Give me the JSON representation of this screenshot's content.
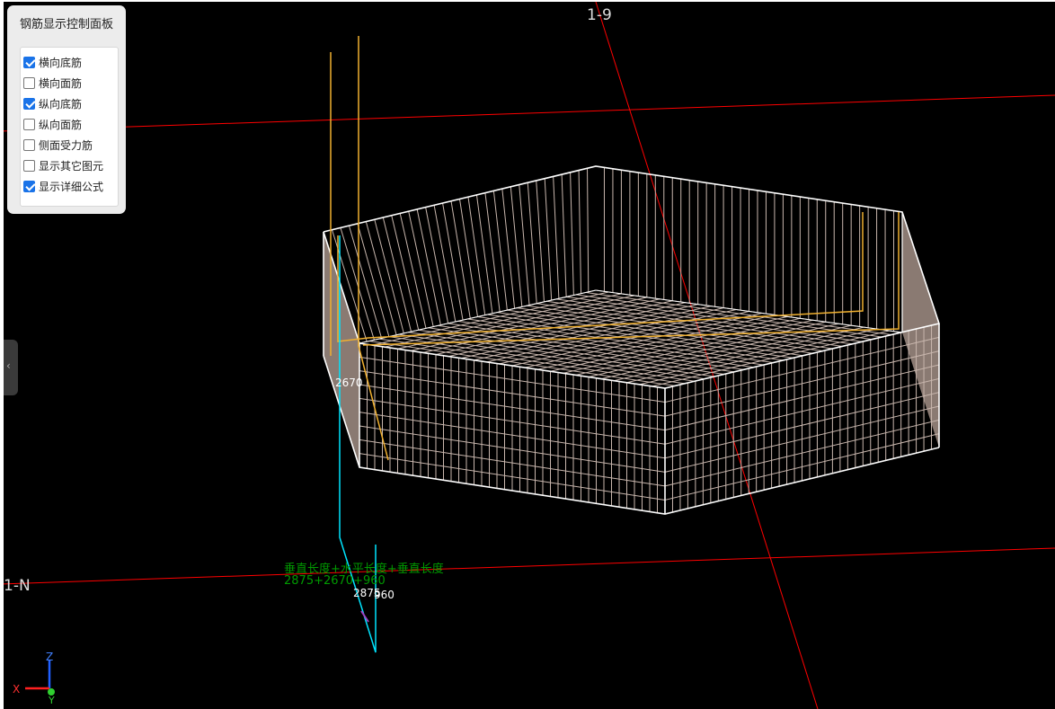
{
  "panel": {
    "title": "钢筋显示控制面板",
    "options": [
      {
        "label": "横向底筋",
        "checked": true
      },
      {
        "label": "横向面筋",
        "checked": false
      },
      {
        "label": "纵向底筋",
        "checked": true
      },
      {
        "label": "纵向面筋",
        "checked": false
      },
      {
        "label": "侧面受力筋",
        "checked": false
      },
      {
        "label": "显示其它图元",
        "checked": false
      },
      {
        "label": "显示详细公式",
        "checked": true
      }
    ]
  },
  "collapse_tab": {
    "icon": "chevron-left-icon",
    "glyph": "‹"
  },
  "scene": {
    "axis_top_label": "1-9",
    "axis_left_label": "1-N",
    "dimension_2670": "2670",
    "dimension_2875": "2875",
    "dimension_960": "960",
    "formula_text": "垂直长度+水平长度+垂直长度",
    "formula_values": "2875+2670+960",
    "gizmo": {
      "x": "X",
      "y": "Y",
      "z": "Z"
    }
  },
  "colors": {
    "background": "#000000",
    "grid_line": "#ff0000",
    "outline": "#ffffff",
    "rebar": "#c8b6ad",
    "highlight_rebar": "#f0b030",
    "selected_rebar": "#00e5ff",
    "formula": "#009a00",
    "checkbox": "#1a73e8"
  }
}
